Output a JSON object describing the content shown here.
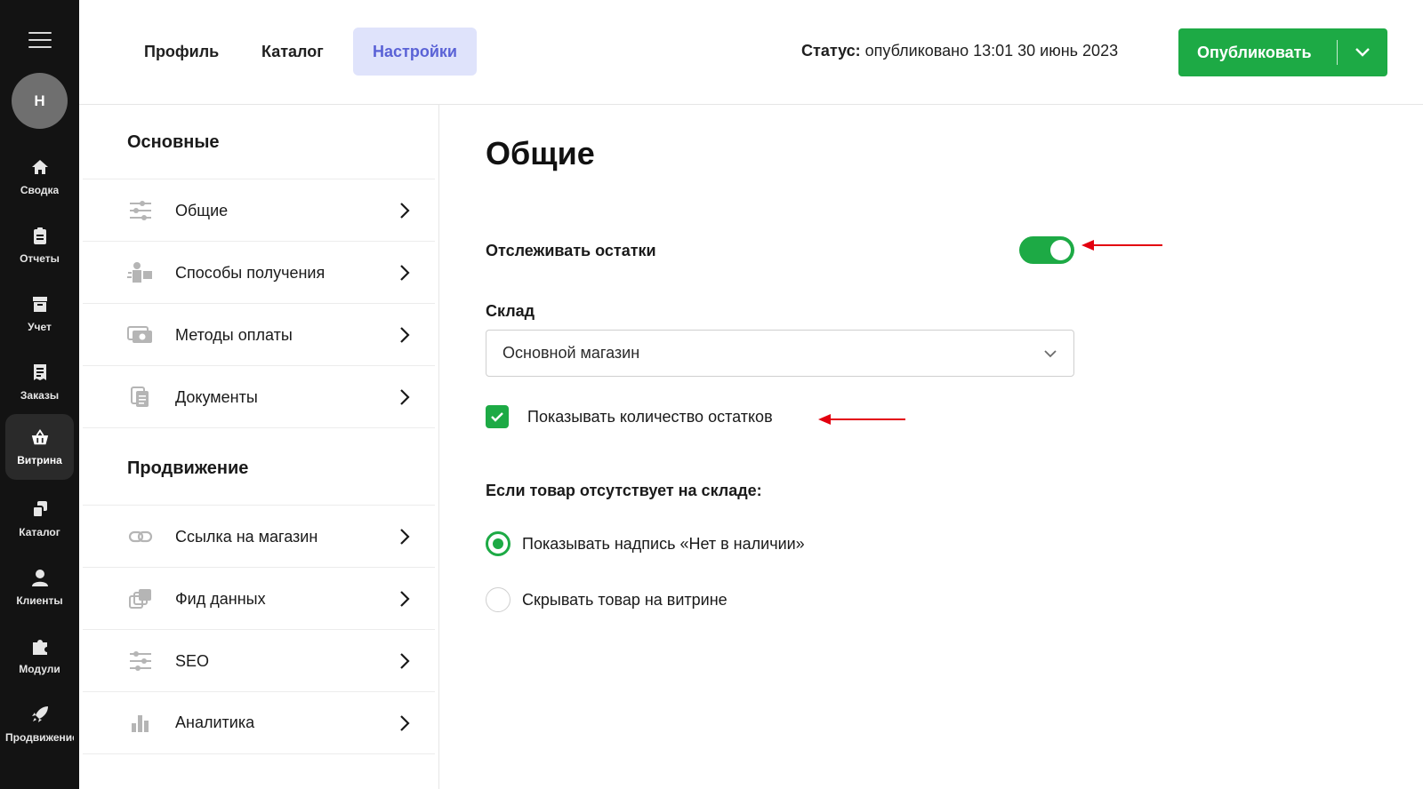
{
  "rail": {
    "avatar_letter": "Н",
    "items": [
      {
        "label": "Сводка",
        "icon": "home-icon"
      },
      {
        "label": "Отчеты",
        "icon": "clipboard-icon"
      },
      {
        "label": "Учет",
        "icon": "archive-icon"
      },
      {
        "label": "Заказы",
        "icon": "receipt-icon"
      },
      {
        "label": "Витрина",
        "icon": "basket-icon",
        "active": true
      },
      {
        "label": "Каталог",
        "icon": "catalog-icon"
      },
      {
        "label": "Клиенты",
        "icon": "user-icon"
      },
      {
        "label": "Модули",
        "icon": "puzzle-icon"
      },
      {
        "label": "Продвижение",
        "icon": "rocket-icon"
      }
    ]
  },
  "topbar": {
    "tabs": [
      {
        "label": "Профиль"
      },
      {
        "label": "Каталог"
      },
      {
        "label": "Настройки",
        "active": true
      }
    ],
    "status_label": "Статус:",
    "status_value": "опубликовано 13:01 30 июнь 2023",
    "publish_label": "Опубликовать"
  },
  "settings_nav": {
    "sections": [
      {
        "title": "Основные",
        "items": [
          {
            "label": "Общие",
            "icon": "sliders-icon"
          },
          {
            "label": "Способы получения",
            "icon": "courier-icon"
          },
          {
            "label": "Методы оплаты",
            "icon": "cash-icon"
          },
          {
            "label": "Документы",
            "icon": "documents-icon"
          }
        ]
      },
      {
        "title": "Продвижение",
        "items": [
          {
            "label": "Ссылка на магазин",
            "icon": "link-icon"
          },
          {
            "label": "Фид данных",
            "icon": "feed-icon"
          },
          {
            "label": "SEO",
            "icon": "sliders-icon"
          },
          {
            "label": "Аналитика",
            "icon": "bar-chart-icon"
          }
        ]
      }
    ]
  },
  "main": {
    "title": "Общие",
    "track_stock_label": "Отслеживать остатки",
    "track_stock_on": true,
    "warehouse_label": "Склад",
    "warehouse_value": "Основной магазин",
    "show_qty_label": "Показывать количество остатков",
    "show_qty_checked": true,
    "out_of_stock_label": "Если товар отсутствует на складе:",
    "options": [
      {
        "label": "Показывать надпись «Нет в наличии»",
        "selected": true
      },
      {
        "label": "Скрывать товар на витрине",
        "selected": false
      }
    ]
  },
  "colors": {
    "accent_green": "#1daa45",
    "tab_active_bg": "#dfe3fb",
    "tab_active_text": "#5a62d6",
    "rail_bg": "#131313",
    "annotation_red": "#e3000f"
  }
}
